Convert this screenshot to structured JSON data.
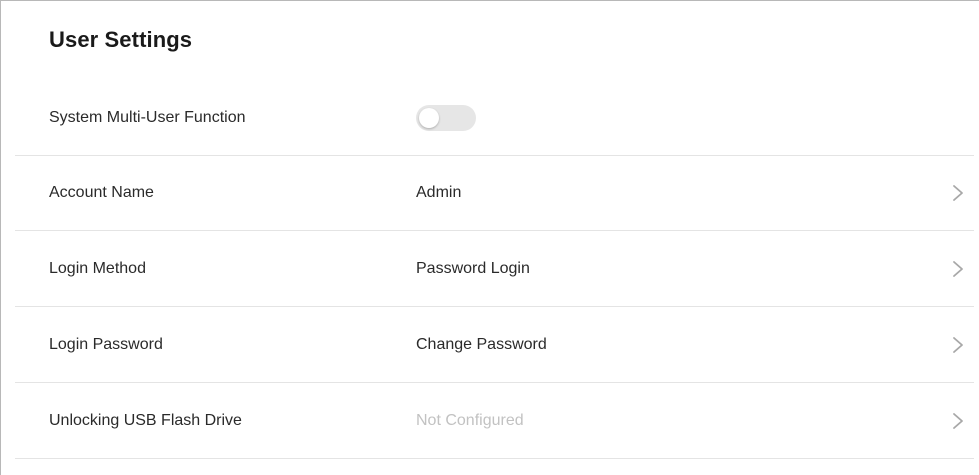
{
  "page": {
    "title": "User Settings"
  },
  "settings": {
    "multi_user": {
      "label": "System Multi-User Function",
      "enabled": false
    },
    "rows": [
      {
        "label": "Account Name",
        "value": "Admin",
        "muted": false
      },
      {
        "label": "Login Method",
        "value": "Password Login",
        "muted": false
      },
      {
        "label": "Login Password",
        "value": "Change Password",
        "muted": false
      },
      {
        "label": "Unlocking USB Flash Drive",
        "value": "Not Configured",
        "muted": true
      }
    ]
  },
  "icons": {
    "chevron": "chevron-right-icon"
  },
  "colors": {
    "text": "#2a2a2a",
    "muted_text": "#c2c2c2",
    "divider": "#e4e4e4",
    "toggle_off": "#e6e6e6"
  }
}
